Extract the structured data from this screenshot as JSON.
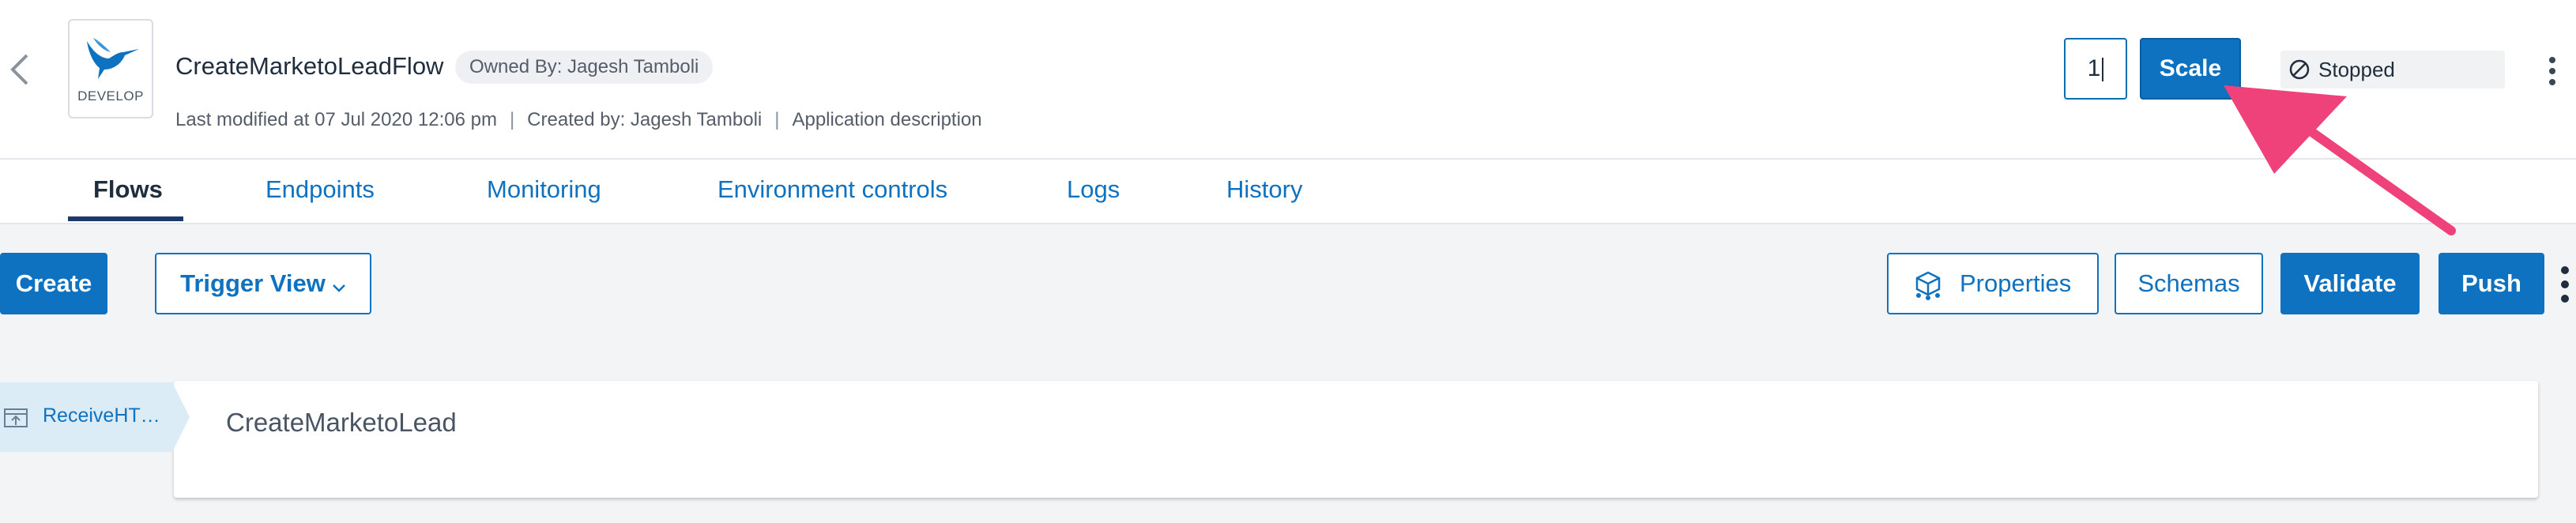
{
  "header": {
    "app_name": "CreateMarketoLeadFlow",
    "app_icon_label": "DEVELOP",
    "owner": "Owned By: Jagesh Tamboli",
    "last_modified": "Last modified at 07 Jul 2020 12:06 pm",
    "created_by": "Created by: Jagesh Tamboli",
    "description": "Application description",
    "separator": "|",
    "scale_value": "1",
    "scale_label": "Scale",
    "status": "Stopped"
  },
  "tabs": [
    {
      "label": "Flows",
      "active": true
    },
    {
      "label": "Endpoints",
      "active": false
    },
    {
      "label": "Monitoring",
      "active": false
    },
    {
      "label": "Environment controls",
      "active": false
    },
    {
      "label": "Logs",
      "active": false
    },
    {
      "label": "History",
      "active": false
    }
  ],
  "toolbar": {
    "create_label": "Create",
    "trigger_view_label": "Trigger View",
    "properties_label": "Properties",
    "schemas_label": "Schemas",
    "validate_label": "Validate",
    "push_label": "Push"
  },
  "flow": {
    "trigger_label": "ReceiveHT…",
    "name": "CreateMarketoLead"
  },
  "icons": {
    "back": "chevron-left-icon",
    "app": "hummingbird-icon",
    "status": "stopped-icon",
    "more": "kebab-icon",
    "properties": "properties-icon",
    "trigger": "http-trigger-icon"
  },
  "colors": {
    "accent": "#0f72c0",
    "tab_active_underline": "#1a3a6a",
    "annotation_arrow": "#f0427a",
    "trigger_tag_bg": "#dcecf7"
  }
}
